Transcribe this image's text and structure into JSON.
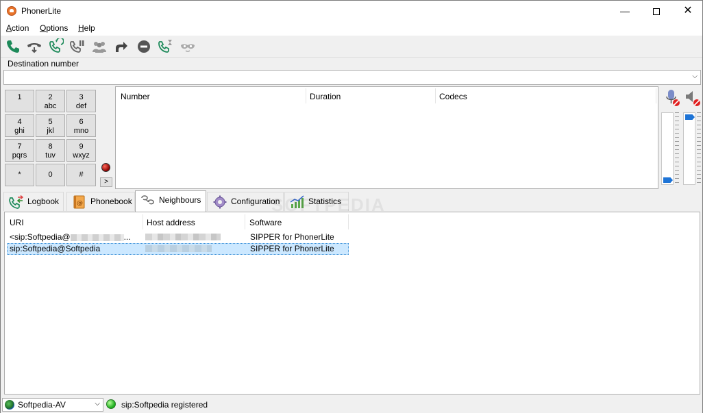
{
  "window": {
    "title": "PhonerLite",
    "minimize": "—",
    "close": "✕"
  },
  "menu": [
    {
      "pre": "",
      "key": "A",
      "post": "ction"
    },
    {
      "pre": "",
      "key": "O",
      "post": "ptions"
    },
    {
      "pre": "",
      "key": "H",
      "post": "elp"
    }
  ],
  "toolbar": {
    "icons": [
      "call-icon",
      "hangup-icon",
      "redial-icon",
      "hold-icon",
      "conference-icon",
      "forward-icon",
      "dnd-icon",
      "callwait-icon",
      "mask-icon"
    ]
  },
  "destination": {
    "label": "Destination number",
    "value": ""
  },
  "keypad": [
    {
      "digit": "1",
      "letters": ""
    },
    {
      "digit": "2",
      "letters": "abc"
    },
    {
      "digit": "3",
      "letters": "def"
    },
    {
      "digit": "4",
      "letters": "ghi"
    },
    {
      "digit": "5",
      "letters": "jkl"
    },
    {
      "digit": "6",
      "letters": "mno"
    },
    {
      "digit": "7",
      "letters": "pqrs"
    },
    {
      "digit": "8",
      "letters": "tuv"
    },
    {
      "digit": "9",
      "letters": "wxyz"
    },
    {
      "digit": "*",
      "letters": ""
    },
    {
      "digit": "0",
      "letters": ""
    },
    {
      "digit": "#",
      "letters": ""
    }
  ],
  "more_button": ">",
  "calls": {
    "columns": [
      "Number",
      "Duration",
      "Codecs"
    ]
  },
  "audio": {
    "mic_level": 0.0,
    "speaker_level": 1.0
  },
  "tabs": [
    {
      "label": "Logbook",
      "icon": "logbook-icon"
    },
    {
      "label": "Phonebook",
      "icon": "phonebook-icon"
    },
    {
      "label": "Neighbours",
      "icon": "neighbours-icon",
      "active": true
    },
    {
      "label": "Configuration",
      "icon": "configuration-icon"
    },
    {
      "label": "Statistics",
      "icon": "statistics-icon"
    }
  ],
  "watermark": "SOFTPEDIA",
  "neighbours": {
    "columns": [
      "URI",
      "Host address",
      "Software"
    ],
    "rows": [
      {
        "uri": "<sip:Softpedia@",
        "uri_suffix": "...",
        "software": "SIPPER for PhonerLite",
        "selected": false
      },
      {
        "uri": "sip:Softpedia@Softpedia",
        "uri_suffix": "",
        "software": "SIPPER for PhonerLite",
        "selected": true
      }
    ]
  },
  "status": {
    "account": "Softpedia-AV",
    "text": "sip:Softpedia registered",
    "led_color": "#1fae1f"
  }
}
